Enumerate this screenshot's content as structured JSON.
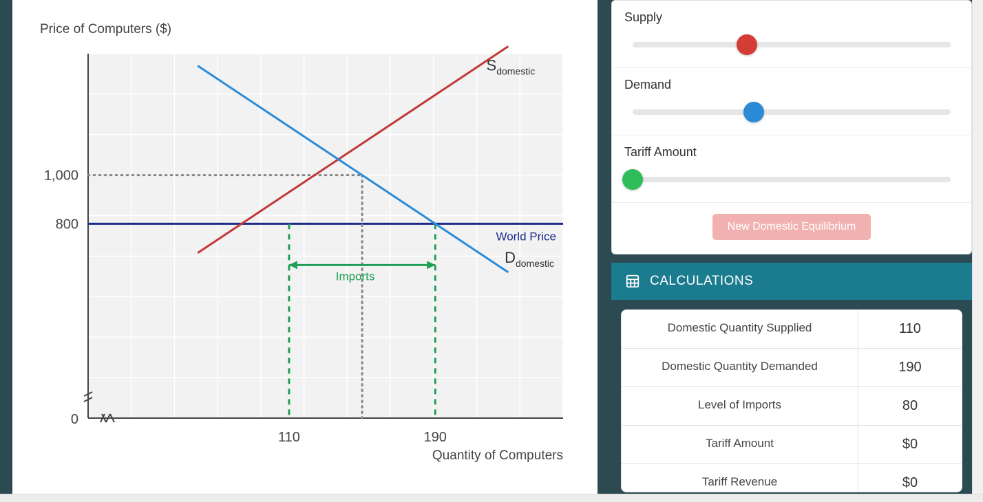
{
  "chart_data": {
    "type": "line",
    "title": "",
    "xlabel": "Quantity of Computers",
    "ylabel": "Price of Computers ($)",
    "x_ticks": [
      0,
      110,
      190
    ],
    "y_ticks": [
      0,
      800,
      1000
    ],
    "xlim": [
      0,
      260
    ],
    "ylim": [
      0,
      1500
    ],
    "series": [
      {
        "name": "S_domestic",
        "label": "S",
        "sublabel": "domestic",
        "color": "#c23838",
        "points": [
          [
            60,
            680
          ],
          [
            230,
            1530
          ]
        ]
      },
      {
        "name": "D_domestic",
        "label": "D",
        "sublabel": "domestic",
        "color": "#2b8bd6",
        "points": [
          [
            60,
            1450
          ],
          [
            230,
            600
          ]
        ]
      },
      {
        "name": "World Price",
        "label": "World Price",
        "color": "#1a2a8a",
        "horizontal_at_y": 800
      }
    ],
    "equilibrium": {
      "q": 150,
      "p": 1000
    },
    "intersections_at_world_price": {
      "qs": 110,
      "qd": 190
    },
    "annotations": [
      {
        "text": "Imports",
        "color": "#1f9e55",
        "between": [
          110,
          190
        ],
        "at_y": 730
      }
    ],
    "y_axis_break": true,
    "x_axis_break": true
  },
  "sliders": {
    "supply": {
      "label": "Supply",
      "position_pct": 36,
      "color": "red"
    },
    "demand": {
      "label": "Demand",
      "position_pct": 38,
      "color": "blue"
    },
    "tariff": {
      "label": "Tariff Amount",
      "position_pct": 0,
      "color": "green"
    }
  },
  "button": {
    "label": "New Domestic Equilibrium"
  },
  "calc_header": "CALCULATIONS",
  "calculations": [
    {
      "label": "Domestic Quantity Supplied",
      "value": "110"
    },
    {
      "label": "Domestic Quantity Demanded",
      "value": "190"
    },
    {
      "label": "Level of Imports",
      "value": "80"
    },
    {
      "label": "Tariff Amount",
      "value": "$0"
    },
    {
      "label": "Tariff Revenue",
      "value": "$0"
    }
  ]
}
